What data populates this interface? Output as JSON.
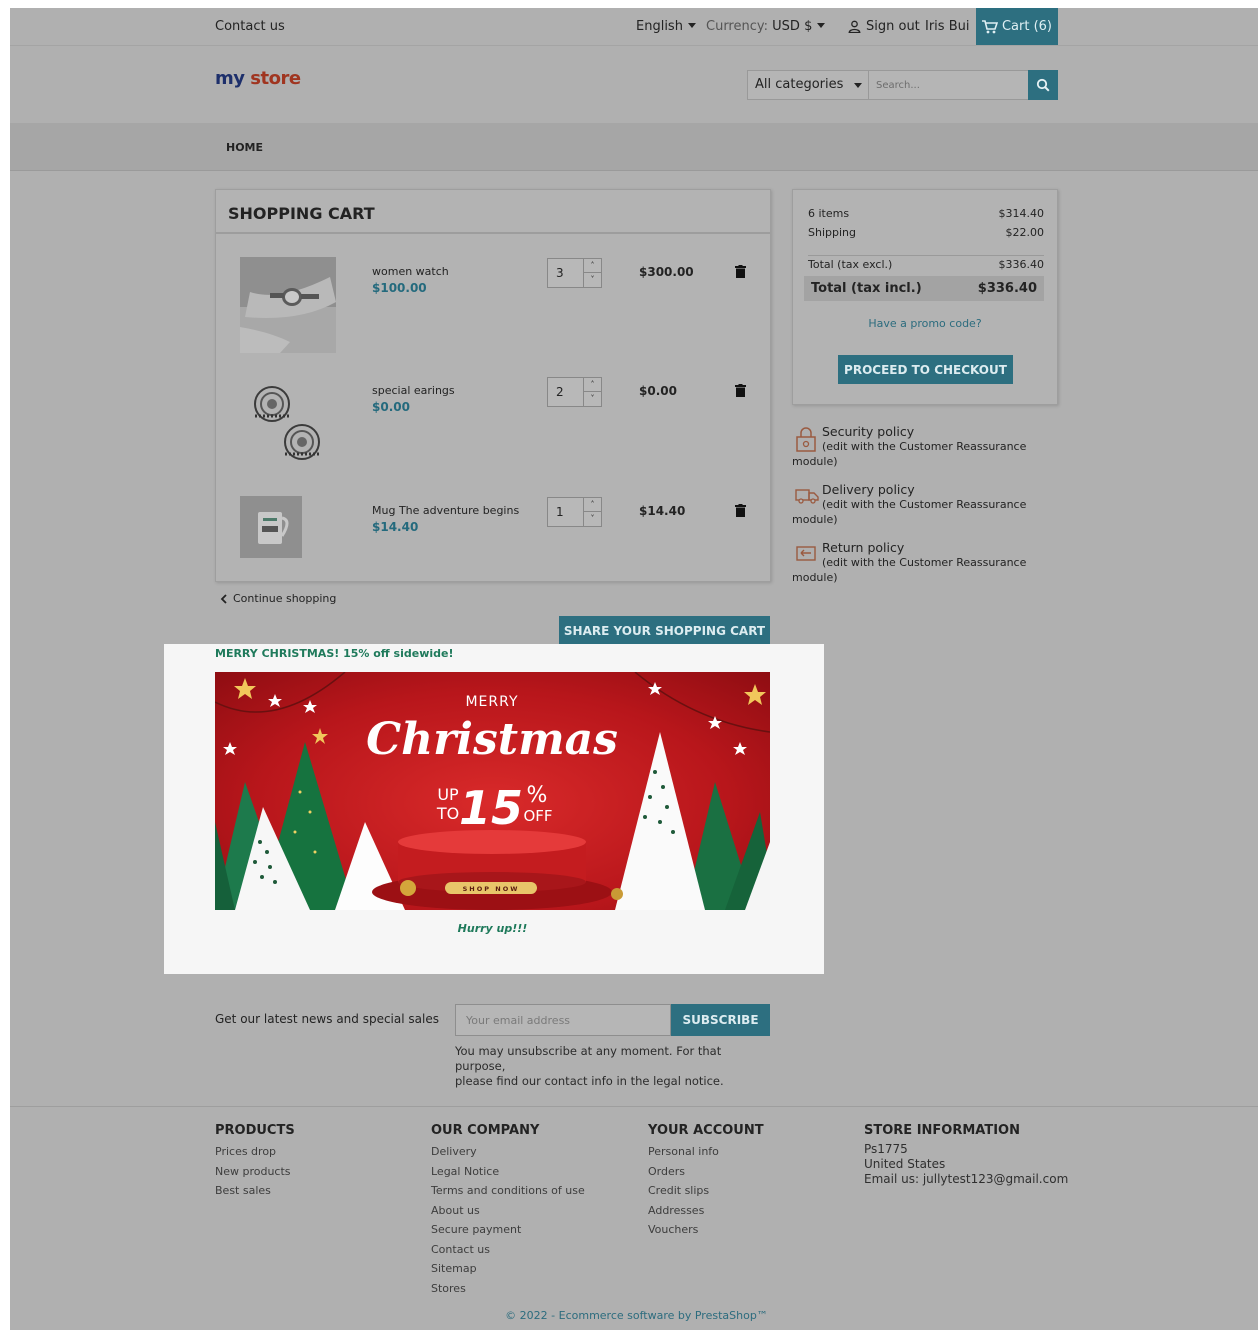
{
  "topbar": {
    "contact": "Contact us",
    "language": "English",
    "currency_label": "Currency:",
    "currency_value": "USD $",
    "signout": "Sign out",
    "user": "Iris Bui",
    "cart": "Cart (6)"
  },
  "header": {
    "logo_part1": "my",
    "logo_part2": "store",
    "category": "All categories",
    "search_placeholder": "Search..."
  },
  "nav": {
    "home": "HOME"
  },
  "cart": {
    "title": "SHOPPING CART",
    "items": [
      {
        "name": "women watch",
        "price": "$100.00",
        "qty": "3",
        "total": "$300.00"
      },
      {
        "name": "special earings",
        "price": "$0.00",
        "qty": "2",
        "total": "$0.00"
      },
      {
        "name": "Mug The adventure begins",
        "price": "$14.40",
        "qty": "1",
        "total": "$14.40"
      }
    ],
    "continue": "Continue shopping",
    "share": "SHARE YOUR SHOPPING CART"
  },
  "summary": {
    "items_label": "6 items",
    "items_value": "$314.40",
    "shipping_label": "Shipping",
    "shipping_value": "$22.00",
    "excl_label": "Total (tax excl.)",
    "excl_value": "$336.40",
    "incl_label": "Total (tax incl.)",
    "incl_value": "$336.40",
    "promo": "Have a promo code?",
    "checkout": "PROCEED TO CHECKOUT"
  },
  "reassurance": [
    {
      "title": "Security policy",
      "line": "(edit with the Customer Reassurance",
      "tail": "module)"
    },
    {
      "title": "Delivery policy",
      "line": "(edit with the Customer Reassurance",
      "tail": "module)"
    },
    {
      "title": "Return policy",
      "line": "(edit with the Customer Reassurance",
      "tail": "module)"
    }
  ],
  "promo_block": {
    "title": "MERRY CHRISTMAS! 15% off sidewide!",
    "banner_merry": "MERRY",
    "banner_christmas": "Christmas",
    "banner_up": "UP",
    "banner_to": "TO",
    "banner_num": "15",
    "banner_pct": "%",
    "banner_off": "OFF",
    "banner_shop": "SHOP NOW",
    "hurry": "Hurry up!!!"
  },
  "newsletter": {
    "label": "Get our latest news and special sales",
    "placeholder": "Your email address",
    "button": "SUBSCRIBE",
    "note1": "You may unsubscribe at any moment. For that purpose,",
    "note2": "please find our contact info in the legal notice."
  },
  "footer": {
    "products": {
      "title": "PRODUCTS",
      "links": [
        "Prices drop",
        "New products",
        "Best sales"
      ]
    },
    "company": {
      "title": "OUR COMPANY",
      "links": [
        "Delivery",
        "Legal Notice",
        "Terms and conditions of use",
        "About us",
        "Secure payment",
        "Contact us",
        "Sitemap",
        "Stores"
      ]
    },
    "account": {
      "title": "YOUR ACCOUNT",
      "links": [
        "Personal info",
        "Orders",
        "Credit slips",
        "Addresses",
        "Vouchers"
      ]
    },
    "store": {
      "title": "STORE INFORMATION",
      "line1": "Ps1775",
      "line2": "United States",
      "line3": "Email us: jullytest123@gmail.com"
    },
    "copyright": "© 2022 - Ecommerce software by PrestaShop™"
  }
}
